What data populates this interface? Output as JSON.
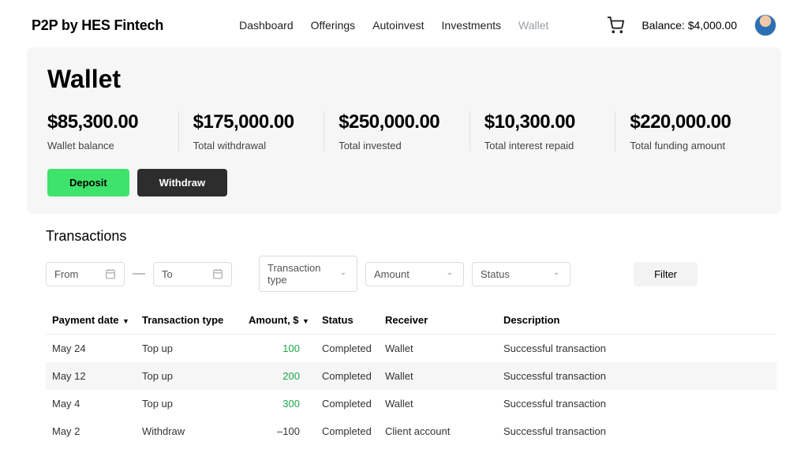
{
  "brand": "P2P by HES Fintech",
  "nav": {
    "dashboard": "Dashboard",
    "offerings": "Offerings",
    "autoinvest": "Autoinvest",
    "investments": "Investments",
    "wallet": "Wallet"
  },
  "header": {
    "balance": "Balance: $4,000.00"
  },
  "wallet": {
    "title": "Wallet",
    "stats": {
      "balance": {
        "value": "$85,300.00",
        "label": "Wallet balance"
      },
      "withdrawal": {
        "value": "$175,000.00",
        "label": "Total withdrawal"
      },
      "invested": {
        "value": "$250,000.00",
        "label": "Total invested"
      },
      "interest": {
        "value": "$10,300.00",
        "label": "Total interest repaid"
      },
      "funding": {
        "value": "$220,000.00",
        "label": "Total funding amount"
      }
    },
    "deposit_btn": "Deposit",
    "withdraw_btn": "Withdraw"
  },
  "transactions": {
    "title": "Transactions",
    "filters": {
      "from": "From",
      "to": "To",
      "type": "Transaction type",
      "amount": "Amount",
      "status": "Status",
      "filter_btn": "Filter"
    },
    "columns": {
      "date": "Payment date",
      "type": "Transaction type",
      "amount": "Amount, $",
      "status": "Status",
      "receiver": "Receiver",
      "description": "Description"
    },
    "rows": [
      {
        "date": "May 24",
        "type": "Top up",
        "amount": "100",
        "amount_class": "pos",
        "status": "Completed",
        "receiver": "Wallet",
        "description": "Successful transaction"
      },
      {
        "date": "May 12",
        "type": "Top up",
        "amount": "200",
        "amount_class": "pos",
        "status": "Completed",
        "receiver": "Wallet",
        "description": "Successful transaction"
      },
      {
        "date": "May 4",
        "type": "Top up",
        "amount": "300",
        "amount_class": "pos",
        "status": "Completed",
        "receiver": "Wallet",
        "description": "Successful transaction"
      },
      {
        "date": "May 2",
        "type": "Withdraw",
        "amount": "–100",
        "amount_class": "",
        "status": "Completed",
        "receiver": "Client account",
        "description": "Successful transaction"
      }
    ]
  }
}
